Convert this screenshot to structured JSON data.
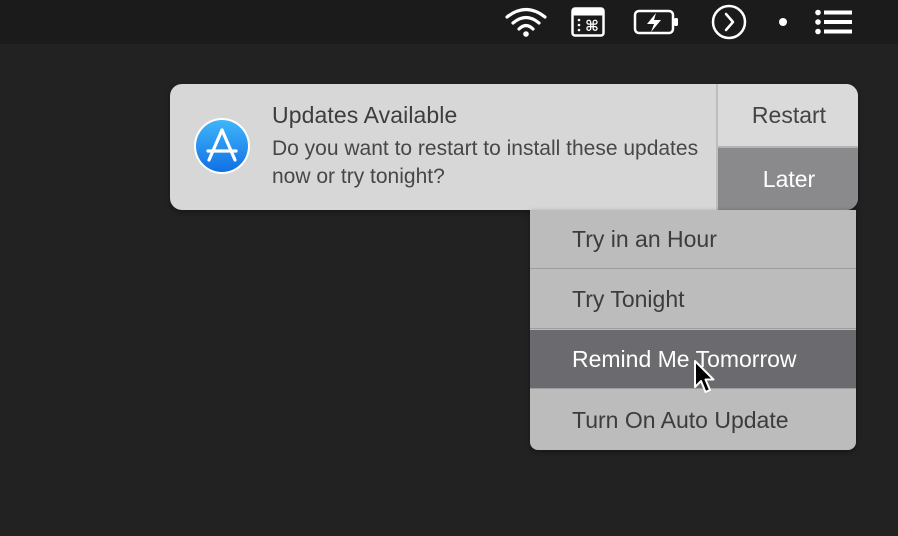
{
  "menubar": {
    "icons": [
      "wifi-icon",
      "keyboard-viewer-icon",
      "battery-charging-icon",
      "clock-icon",
      "dot-icon",
      "notification-center-icon"
    ]
  },
  "notification": {
    "app_icon": "app-store-icon",
    "title": "Updates Available",
    "body": "Do you want to restart to install these updates now or try tonight?",
    "actions": {
      "restart_label": "Restart",
      "later_label": "Later"
    }
  },
  "later_menu": {
    "items": [
      {
        "label": "Try in an Hour"
      },
      {
        "label": "Try Tonight"
      },
      {
        "label": "Remind Me Tomorrow"
      },
      {
        "label": "Turn On Auto Update"
      }
    ],
    "highlighted": "Remind Me Tomorrow"
  },
  "colors": {
    "desktop": "#222222",
    "menubar": "#1b1b1b",
    "banner": "#d7d7d7",
    "later_button": "#8a8a8c",
    "menu": "#bcbcbc",
    "menu_highlight": "#6b6b6f",
    "app_icon_blue": "#1a8ff0"
  }
}
